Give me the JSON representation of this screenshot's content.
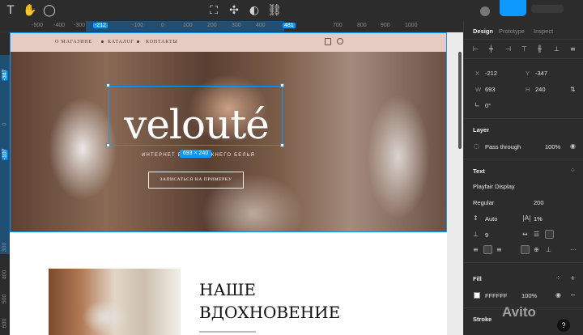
{
  "toolbar": {
    "left_icons": [
      "text-tool-icon",
      "hand-tool-icon",
      "comment-tool-icon"
    ],
    "center_icons": [
      "frame-icon",
      "component-icon",
      "contrast-icon",
      "link-icon"
    ]
  },
  "ruler": {
    "h_labels": [
      "-500",
      "-400",
      "-300",
      "-212",
      "-100",
      "0",
      "100",
      "200",
      "300",
      "400",
      "481",
      "700",
      "800",
      "900",
      "1000"
    ],
    "h_selected": [
      "-212",
      "481"
    ],
    "v_labels": [
      "-347",
      "0",
      "-107",
      "300",
      "400",
      "500",
      "600"
    ],
    "v_selected": [
      "-347",
      "-107"
    ]
  },
  "site": {
    "nav": [
      "О МАГАЗИНЕ",
      "КАТАЛОГ",
      "КОНТАКТЫ"
    ],
    "hero_title": "velouté",
    "hero_subtitle": "ИНТЕРНЕТ БУТИК НИЖНЕГО БЕЛЬЯ",
    "cta": "ЗАПИСАТЬСЯ НА ПРИМЕРКУ",
    "section_title_line1": "НАШЕ",
    "section_title_line2": "ВДОХНОВЕНИЕ"
  },
  "selection": {
    "size_badge": "693 × 240"
  },
  "panel": {
    "tabs": [
      "Design",
      "Prototype",
      "Inspect"
    ],
    "active_tab": "Design",
    "x_label": "X",
    "x_value": "-212",
    "y_label": "Y",
    "y_value": "-347",
    "w_label": "W",
    "w_value": "693",
    "h_label": "H",
    "h_value": "240",
    "rotation": "0°",
    "layer_title": "Layer",
    "blend_mode": "Pass through",
    "layer_opacity": "100%",
    "text_title": "Text",
    "font_family": "Playfair Display",
    "font_weight": "Regular",
    "font_size": "200",
    "line_height": "Auto",
    "letter_spacing": "1%",
    "paragraph_spacing": "9",
    "fill_title": "Fill",
    "fill_hex": "FFFFFF",
    "fill_opacity": "100%",
    "stroke_title": "Stroke"
  },
  "watermark": "Avito",
  "help": "?",
  "colors": {
    "accent": "#0d99ff",
    "header_bg": "#e5cbc2",
    "panel_bg": "#2c2c2c"
  }
}
